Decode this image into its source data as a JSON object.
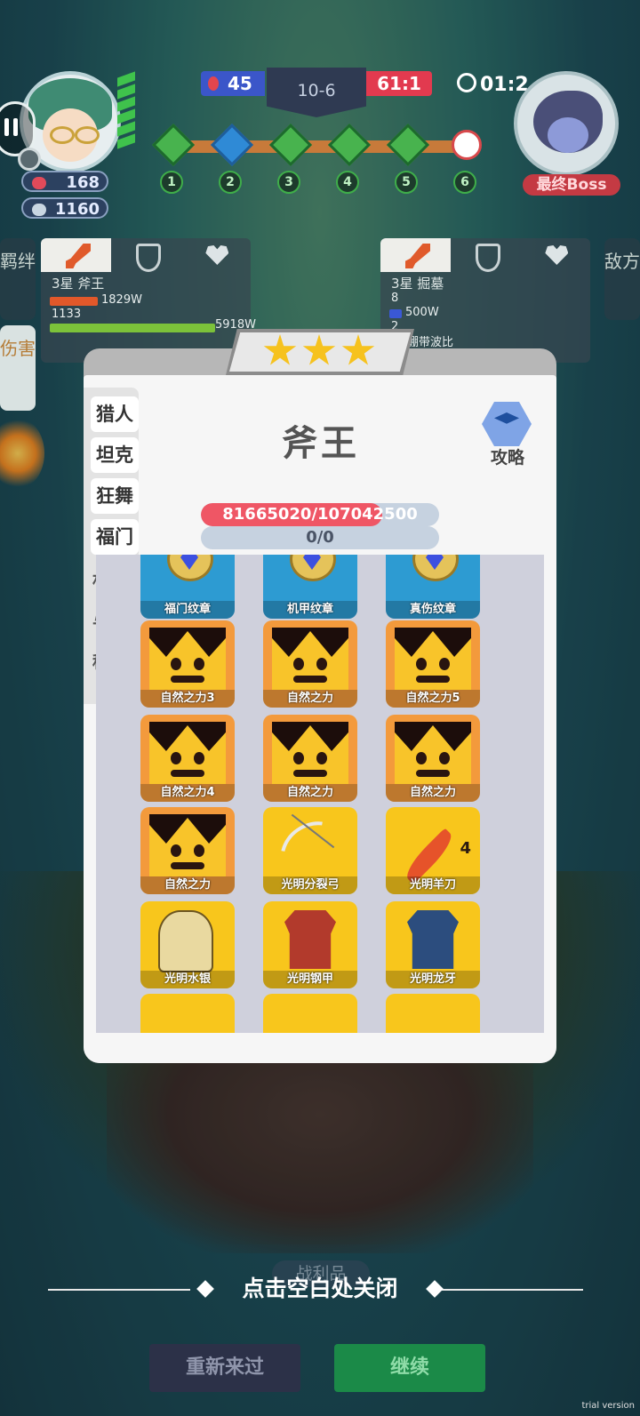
{
  "hud": {
    "hearts": "168",
    "coins": "1160",
    "score_left": "45",
    "level": "10-6",
    "score_right": "61:1",
    "timer": "01:2",
    "boss_label": "最终Boss",
    "stages": [
      "1",
      "2",
      "3",
      "4",
      "5",
      "6"
    ]
  },
  "side_tabs": {
    "left_top": "羁绊",
    "left_active": "伤害",
    "right_top": "敌方"
  },
  "left_panel": {
    "name": "3星 斧王",
    "value1": "1829W",
    "value2": "1133",
    "value3": "5918W"
  },
  "right_panel": {
    "name": "3星 掘墓",
    "value1": "8",
    "value2": "500W",
    "value3": "2",
    "value4": "绷带波比"
  },
  "dialog": {
    "stars": 3,
    "hero_name": "斧王",
    "strategy_label": "攻略",
    "hp_text": "81665020/107042500",
    "hp_ratio": 0.763,
    "shield_text": "0/0",
    "categories": [
      "猎人",
      "坦克",
      "狂舞",
      "福门"
    ],
    "categories_partial": [
      "村",
      "与",
      "种"
    ]
  },
  "items": [
    {
      "name": "福门纹章",
      "kind": "emblem"
    },
    {
      "name": "机甲纹章",
      "kind": "emblem"
    },
    {
      "name": "真伤纹章",
      "kind": "emblem"
    },
    {
      "name": "自然之力3",
      "kind": "crown"
    },
    {
      "name": "自然之力",
      "kind": "crown"
    },
    {
      "name": "自然之力5",
      "kind": "crown"
    },
    {
      "name": "自然之力4",
      "kind": "crown"
    },
    {
      "name": "自然之力",
      "kind": "crown"
    },
    {
      "name": "自然之力",
      "kind": "crown"
    },
    {
      "name": "自然之力",
      "kind": "crown"
    },
    {
      "name": "光明分裂弓",
      "kind": "bow"
    },
    {
      "name": "光明羊刀",
      "kind": "blade",
      "badge": "4"
    },
    {
      "name": "光明水银",
      "kind": "helm"
    },
    {
      "name": "光明钢甲",
      "kind": "armor-red"
    },
    {
      "name": "光明龙牙",
      "kind": "armor-blue"
    }
  ],
  "bottom": {
    "close_hint": "点击空白处关闭",
    "loot_tab": "战利品",
    "restart": "重新来过",
    "continue": "继续",
    "watermark": "trial version"
  }
}
